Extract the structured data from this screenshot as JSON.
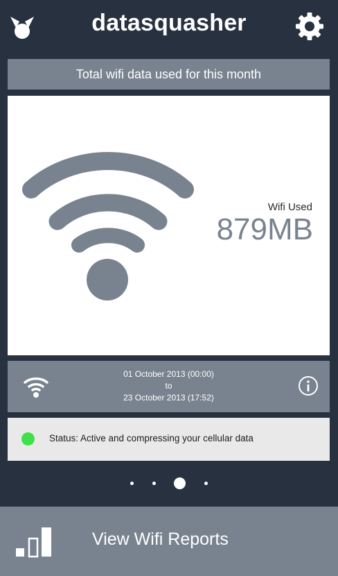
{
  "header": {
    "title": "datasquasher",
    "logo_icon": "bowtie-logo-icon",
    "settings_icon": "gear-icon"
  },
  "banner": {
    "text": "Total wifi data used for this month"
  },
  "usage": {
    "icon": "wifi-icon",
    "label": "Wifi Used",
    "value": "879MB"
  },
  "period": {
    "start": "01 October 2013 (00:00)",
    "separator": "to",
    "end": "23 October 2013 (17:52)",
    "info_icon": "info-icon"
  },
  "status": {
    "text": "Status: Active and compressing your cellular data",
    "color": "#3fe14a"
  },
  "pager": {
    "pages": 4,
    "active": 3
  },
  "footer": {
    "label": "View Wifi Reports",
    "icon": "bar-chart-icon"
  },
  "colors": {
    "background": "#273140",
    "accent_gray": "#79838f",
    "card": "#ffffff",
    "status_bar": "#e9e9e9"
  }
}
